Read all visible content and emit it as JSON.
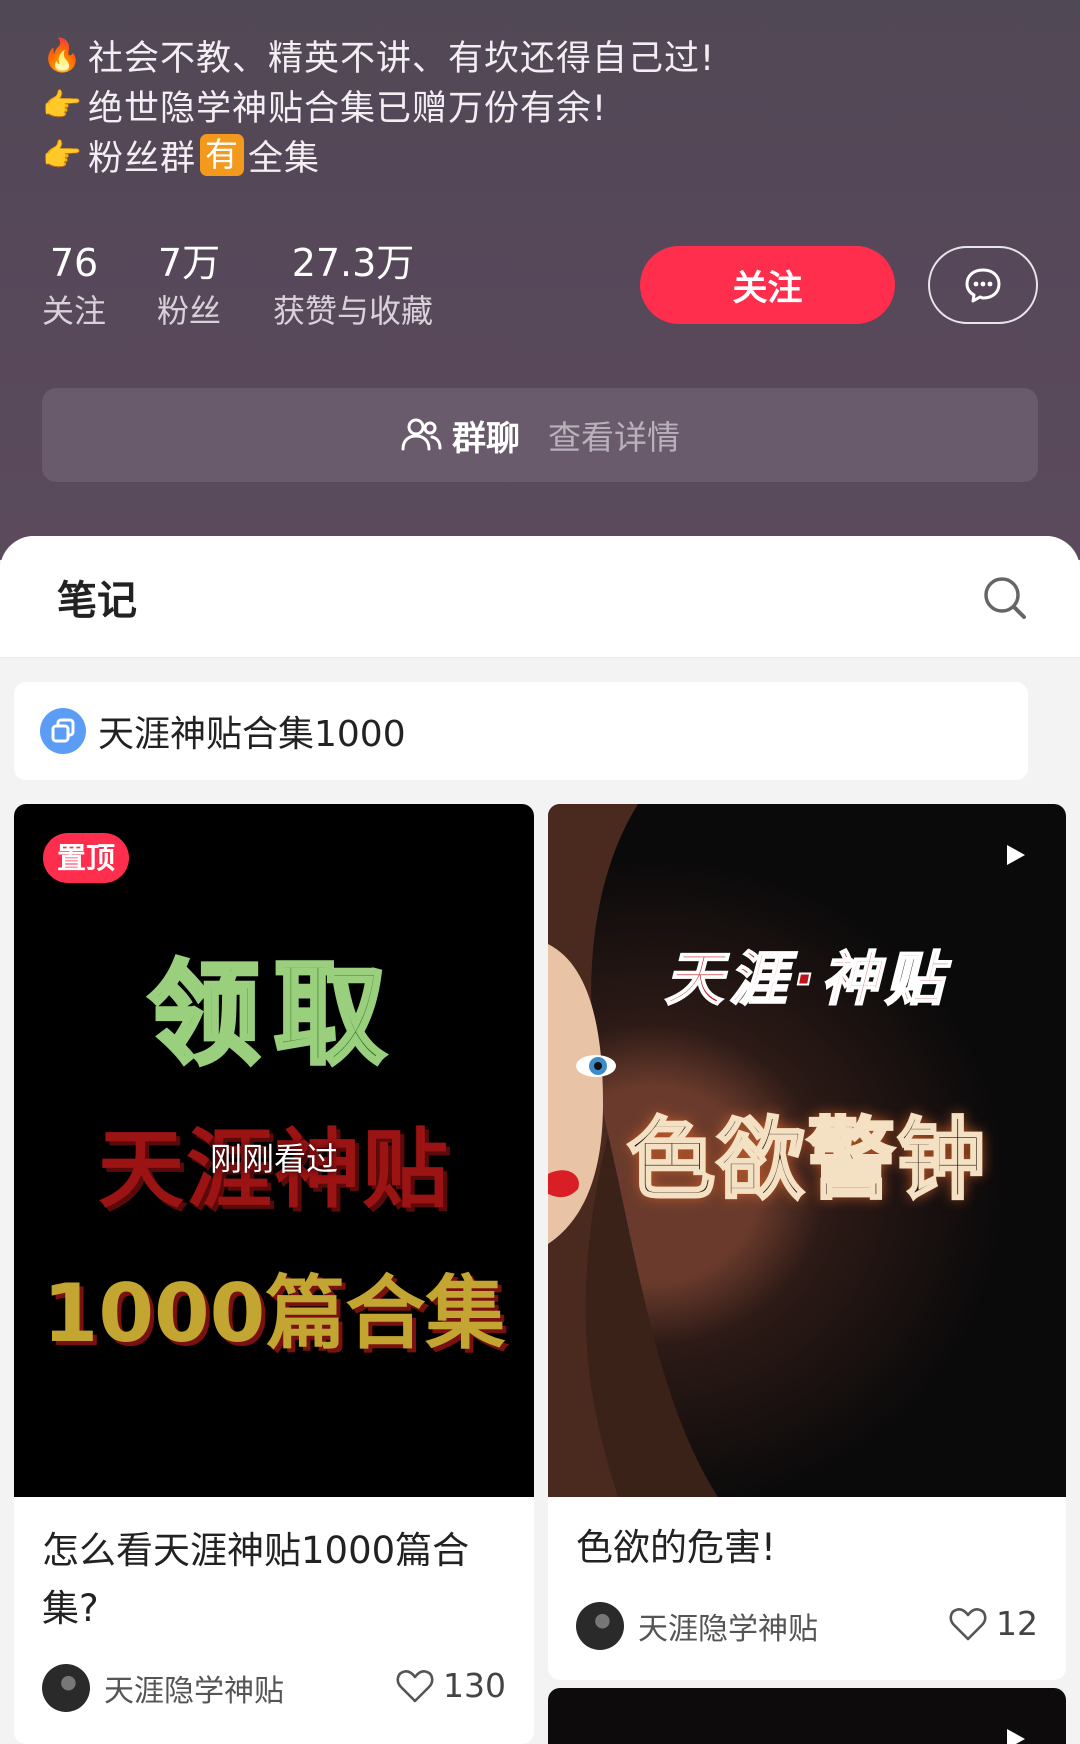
{
  "profile": {
    "bio": [
      {
        "emoji": "🔥",
        "text": "社会不教、精英不讲、有坎还得自己过!"
      },
      {
        "emoji": "👉",
        "text": "绝世隐学神贴合集已赠万份有余!"
      },
      {
        "emoji": "👉",
        "text_before": "粉丝群",
        "tag": "有",
        "text_after": "全集"
      }
    ],
    "stats": [
      {
        "value": "76",
        "label": "关注"
      },
      {
        "value": "7万",
        "label": "粉丝"
      },
      {
        "value": "27.3万",
        "label": "获赞与收藏"
      }
    ],
    "follow_label": "关注",
    "group": {
      "title": "群聊",
      "detail": "查看详情"
    }
  },
  "notes": {
    "title": "笔记",
    "collection": "天涯神贴合集1000",
    "cards": [
      {
        "pin": "置顶",
        "cover_lines": [
          "领取",
          "天涯神贴",
          "1000篇合集"
        ],
        "seen": "刚刚看过",
        "title": "怎么看天涯神贴1000篇合集?",
        "author": "天涯隐学神贴",
        "likes": "130"
      },
      {
        "cover_lines": [
          "天涯·神贴",
          "色欲警钟"
        ],
        "title": "色欲的危害!",
        "author": "天涯隐学神贴",
        "likes": "12"
      }
    ]
  },
  "colors": {
    "accent": "#ff2e4d",
    "header_bg": "#564859",
    "collection_icon": "#5b9cf5"
  },
  "icons": [
    "fire-icon",
    "pointing-hand-icon",
    "chat-bubble-icon",
    "group-people-icon",
    "search-icon",
    "collection-icon",
    "play-icon",
    "heart-icon"
  ]
}
